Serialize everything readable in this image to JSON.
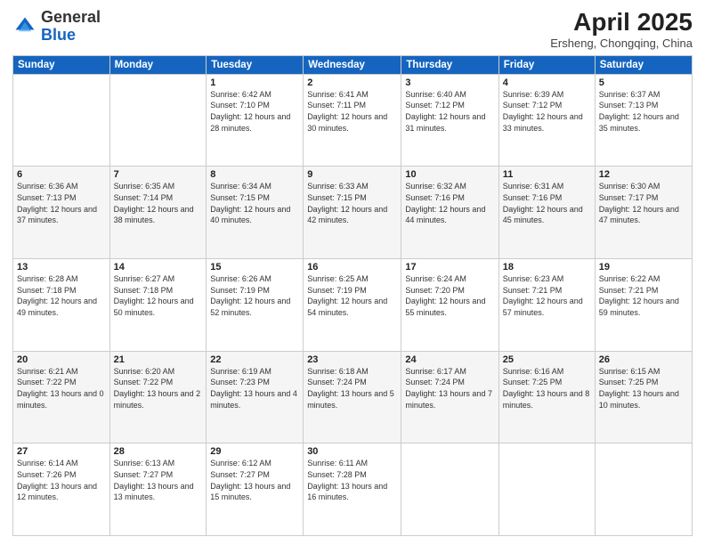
{
  "header": {
    "logo_general": "General",
    "logo_blue": "Blue",
    "month_title": "April 2025",
    "location": "Ersheng, Chongqing, China"
  },
  "days_of_week": [
    "Sunday",
    "Monday",
    "Tuesday",
    "Wednesday",
    "Thursday",
    "Friday",
    "Saturday"
  ],
  "weeks": [
    [
      {
        "day": "",
        "detail": ""
      },
      {
        "day": "",
        "detail": ""
      },
      {
        "day": "1",
        "detail": "Sunrise: 6:42 AM\nSunset: 7:10 PM\nDaylight: 12 hours and 28 minutes."
      },
      {
        "day": "2",
        "detail": "Sunrise: 6:41 AM\nSunset: 7:11 PM\nDaylight: 12 hours and 30 minutes."
      },
      {
        "day": "3",
        "detail": "Sunrise: 6:40 AM\nSunset: 7:12 PM\nDaylight: 12 hours and 31 minutes."
      },
      {
        "day": "4",
        "detail": "Sunrise: 6:39 AM\nSunset: 7:12 PM\nDaylight: 12 hours and 33 minutes."
      },
      {
        "day": "5",
        "detail": "Sunrise: 6:37 AM\nSunset: 7:13 PM\nDaylight: 12 hours and 35 minutes."
      }
    ],
    [
      {
        "day": "6",
        "detail": "Sunrise: 6:36 AM\nSunset: 7:13 PM\nDaylight: 12 hours and 37 minutes."
      },
      {
        "day": "7",
        "detail": "Sunrise: 6:35 AM\nSunset: 7:14 PM\nDaylight: 12 hours and 38 minutes."
      },
      {
        "day": "8",
        "detail": "Sunrise: 6:34 AM\nSunset: 7:15 PM\nDaylight: 12 hours and 40 minutes."
      },
      {
        "day": "9",
        "detail": "Sunrise: 6:33 AM\nSunset: 7:15 PM\nDaylight: 12 hours and 42 minutes."
      },
      {
        "day": "10",
        "detail": "Sunrise: 6:32 AM\nSunset: 7:16 PM\nDaylight: 12 hours and 44 minutes."
      },
      {
        "day": "11",
        "detail": "Sunrise: 6:31 AM\nSunset: 7:16 PM\nDaylight: 12 hours and 45 minutes."
      },
      {
        "day": "12",
        "detail": "Sunrise: 6:30 AM\nSunset: 7:17 PM\nDaylight: 12 hours and 47 minutes."
      }
    ],
    [
      {
        "day": "13",
        "detail": "Sunrise: 6:28 AM\nSunset: 7:18 PM\nDaylight: 12 hours and 49 minutes."
      },
      {
        "day": "14",
        "detail": "Sunrise: 6:27 AM\nSunset: 7:18 PM\nDaylight: 12 hours and 50 minutes."
      },
      {
        "day": "15",
        "detail": "Sunrise: 6:26 AM\nSunset: 7:19 PM\nDaylight: 12 hours and 52 minutes."
      },
      {
        "day": "16",
        "detail": "Sunrise: 6:25 AM\nSunset: 7:19 PM\nDaylight: 12 hours and 54 minutes."
      },
      {
        "day": "17",
        "detail": "Sunrise: 6:24 AM\nSunset: 7:20 PM\nDaylight: 12 hours and 55 minutes."
      },
      {
        "day": "18",
        "detail": "Sunrise: 6:23 AM\nSunset: 7:21 PM\nDaylight: 12 hours and 57 minutes."
      },
      {
        "day": "19",
        "detail": "Sunrise: 6:22 AM\nSunset: 7:21 PM\nDaylight: 12 hours and 59 minutes."
      }
    ],
    [
      {
        "day": "20",
        "detail": "Sunrise: 6:21 AM\nSunset: 7:22 PM\nDaylight: 13 hours and 0 minutes."
      },
      {
        "day": "21",
        "detail": "Sunrise: 6:20 AM\nSunset: 7:22 PM\nDaylight: 13 hours and 2 minutes."
      },
      {
        "day": "22",
        "detail": "Sunrise: 6:19 AM\nSunset: 7:23 PM\nDaylight: 13 hours and 4 minutes."
      },
      {
        "day": "23",
        "detail": "Sunrise: 6:18 AM\nSunset: 7:24 PM\nDaylight: 13 hours and 5 minutes."
      },
      {
        "day": "24",
        "detail": "Sunrise: 6:17 AM\nSunset: 7:24 PM\nDaylight: 13 hours and 7 minutes."
      },
      {
        "day": "25",
        "detail": "Sunrise: 6:16 AM\nSunset: 7:25 PM\nDaylight: 13 hours and 8 minutes."
      },
      {
        "day": "26",
        "detail": "Sunrise: 6:15 AM\nSunset: 7:25 PM\nDaylight: 13 hours and 10 minutes."
      }
    ],
    [
      {
        "day": "27",
        "detail": "Sunrise: 6:14 AM\nSunset: 7:26 PM\nDaylight: 13 hours and 12 minutes."
      },
      {
        "day": "28",
        "detail": "Sunrise: 6:13 AM\nSunset: 7:27 PM\nDaylight: 13 hours and 13 minutes."
      },
      {
        "day": "29",
        "detail": "Sunrise: 6:12 AM\nSunset: 7:27 PM\nDaylight: 13 hours and 15 minutes."
      },
      {
        "day": "30",
        "detail": "Sunrise: 6:11 AM\nSunset: 7:28 PM\nDaylight: 13 hours and 16 minutes."
      },
      {
        "day": "",
        "detail": ""
      },
      {
        "day": "",
        "detail": ""
      },
      {
        "day": "",
        "detail": ""
      }
    ]
  ]
}
